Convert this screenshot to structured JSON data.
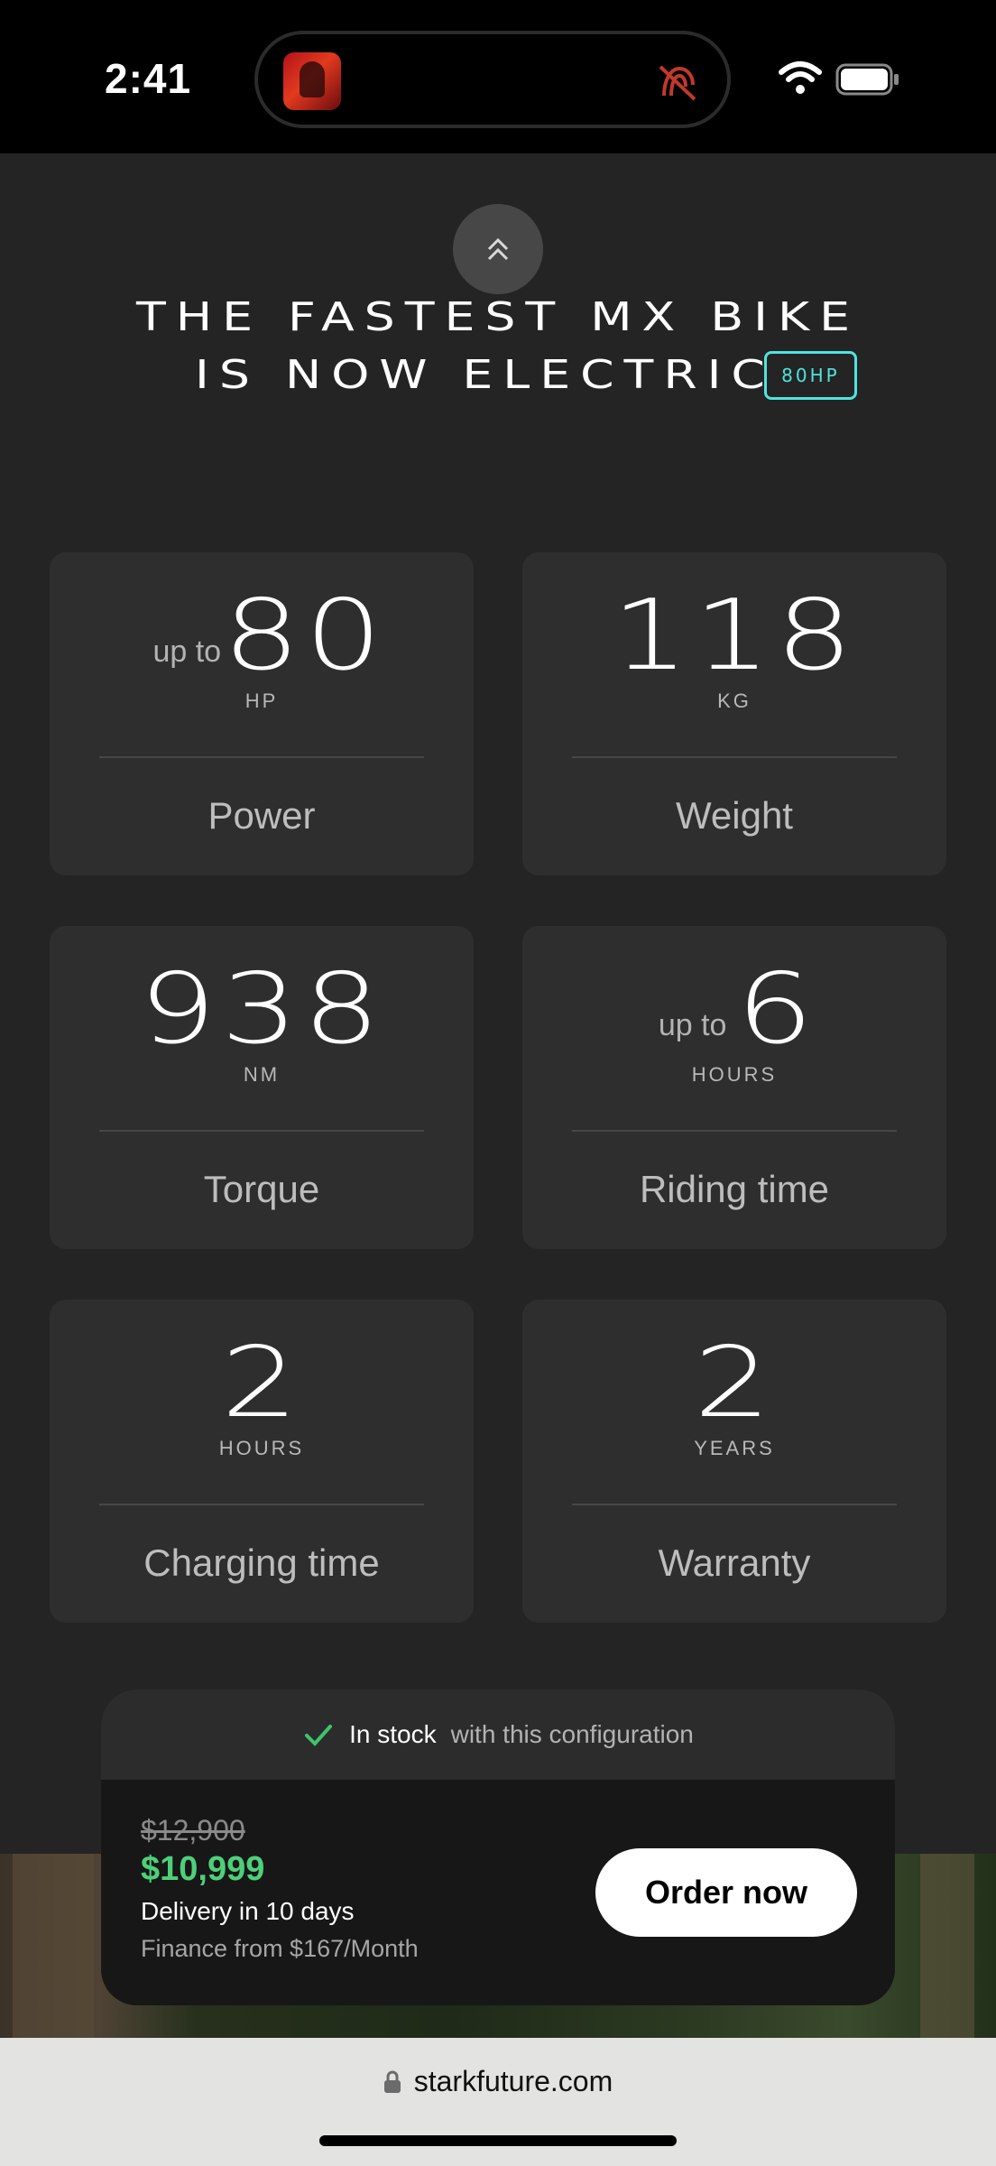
{
  "status_bar": {
    "time": "2:41",
    "icons": [
      "album-art-icon",
      "mute-icon",
      "wifi-icon",
      "battery-icon"
    ]
  },
  "hero": {
    "line1": "THE FASTEST MX BIKE",
    "line2": "IS NOW ELECTRIC",
    "badge": "80HP",
    "badge_color": "#4fe3df"
  },
  "specs": [
    {
      "prefix": "up to",
      "value": "80",
      "unit": "HP",
      "label": "Power"
    },
    {
      "prefix": "",
      "value": "118",
      "unit": "KG",
      "label": "Weight"
    },
    {
      "prefix": "",
      "value": "938",
      "unit": "NM",
      "label": "Torque"
    },
    {
      "prefix": "up to",
      "value": "6",
      "unit": "HOURS",
      "label": "Riding time"
    },
    {
      "prefix": "",
      "value": "2",
      "unit": "HOURS",
      "label": "Charging time"
    },
    {
      "prefix": "",
      "value": "2",
      "unit": "YEARS",
      "label": "Warranty"
    }
  ],
  "order": {
    "stock_status": "In stock",
    "stock_note": "with this configuration",
    "old_price": "$12,900",
    "price": "$10,999",
    "price_color": "#4dd07a",
    "delivery": "Delivery in 10 days",
    "finance": "Finance from $167/Month",
    "button_label": "Order now"
  },
  "browser": {
    "url": "starkfuture.com"
  }
}
